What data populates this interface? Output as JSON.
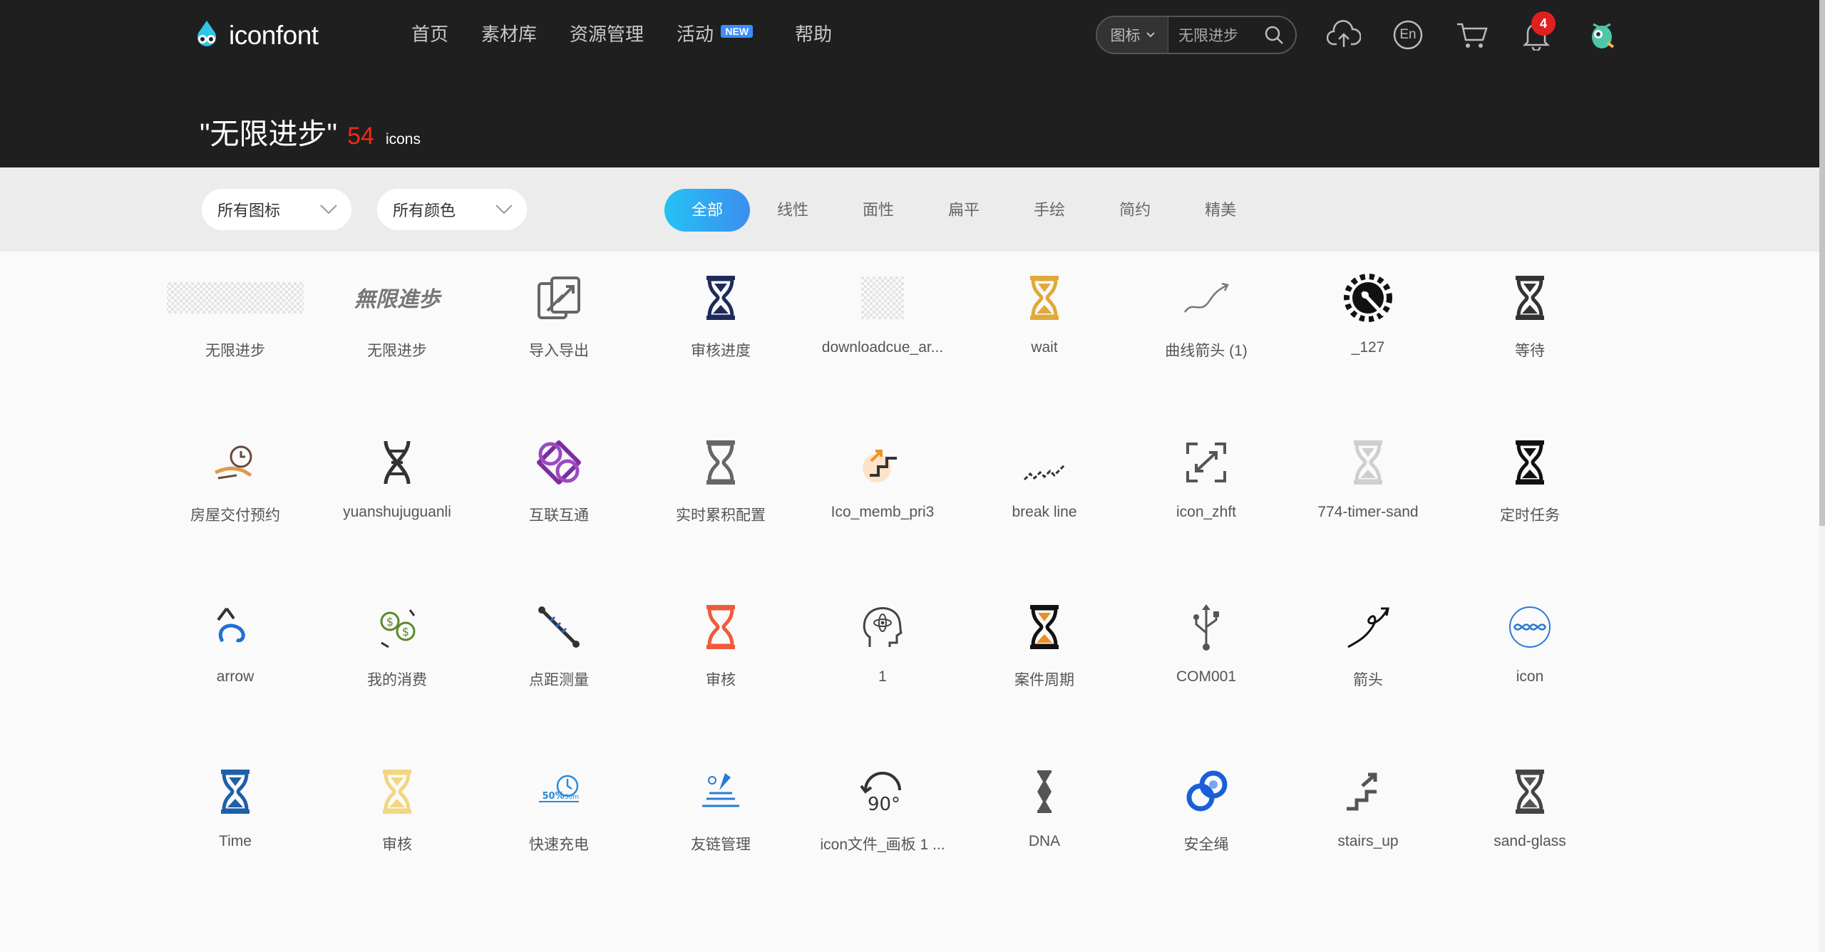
{
  "header": {
    "logo_text": "iconfont",
    "nav": [
      {
        "label": "首页"
      },
      {
        "label": "素材库"
      },
      {
        "label": "资源管理"
      },
      {
        "label": "活动",
        "badge": "NEW"
      },
      {
        "label": "帮助"
      }
    ],
    "search": {
      "type": "图标",
      "value": "无限进步"
    },
    "lang": "En",
    "notifications": "4"
  },
  "title": {
    "query": "\"无限进步\"",
    "count": "54",
    "unit": "icons"
  },
  "filters": {
    "type_dropdown": "所有图标",
    "color_dropdown": "所有颜色",
    "tabs": [
      "全部",
      "线性",
      "面性",
      "扁平",
      "手绘",
      "简约",
      "精美"
    ],
    "active_tab": "全部"
  },
  "colors": {
    "accent_start": "#25c2f2",
    "accent_end": "#3b8ef0",
    "count_red": "#f02a1a",
    "header_bg": "#1f1f1f"
  },
  "icons": [
    {
      "name": "无限进步",
      "icon": "checker-text"
    },
    {
      "name": "无限进步",
      "icon": "stylized-text"
    },
    {
      "name": "导入导出",
      "icon": "import-export-icon"
    },
    {
      "name": "审核进度",
      "icon": "hourglass-navy"
    },
    {
      "name": "downloadcue_ar...",
      "icon": "checker-blank"
    },
    {
      "name": "wait",
      "icon": "hourglass-gold"
    },
    {
      "name": "曲线箭头 (1)",
      "icon": "curve-arrow"
    },
    {
      "name": "_127",
      "icon": "gear-black"
    },
    {
      "name": "等待",
      "icon": "hourglass-outline"
    },
    {
      "name": "房屋交付预约",
      "icon": "hand-clock"
    },
    {
      "name": "yuanshujuguanli",
      "icon": "dna-dark"
    },
    {
      "name": "互联互通",
      "icon": "interlink-purple"
    },
    {
      "name": "实时累积配置",
      "icon": "hourglass-gray"
    },
    {
      "name": "Ico_memb_pri3",
      "icon": "stairs-orange"
    },
    {
      "name": "break line",
      "icon": "break-line"
    },
    {
      "name": "icon_zhft",
      "icon": "swap-box"
    },
    {
      "name": "774-timer-sand",
      "icon": "hourglass-light"
    },
    {
      "name": "定时任务",
      "icon": "hourglass-bold"
    },
    {
      "name": "arrow",
      "icon": "arrow-swirl"
    },
    {
      "name": "我的消费",
      "icon": "money-green"
    },
    {
      "name": "点距测量",
      "icon": "measure"
    },
    {
      "name": "审核",
      "icon": "hourglass-red"
    },
    {
      "name": "1",
      "icon": "head-atom"
    },
    {
      "name": "案件周期",
      "icon": "hourglass-black-orange"
    },
    {
      "name": "COM001",
      "icon": "usb"
    },
    {
      "name": "箭头",
      "icon": "arrow-loop"
    },
    {
      "name": "icon",
      "icon": "dna-circle"
    },
    {
      "name": "Time",
      "icon": "hourglass-blue"
    },
    {
      "name": "审核",
      "icon": "hourglass-yellow"
    },
    {
      "name": "快速充电",
      "icon": "fast-charge"
    },
    {
      "name": "友链管理",
      "icon": "link-manage"
    },
    {
      "name": "icon文件_画板 1 ...",
      "icon": "rotate-90"
    },
    {
      "name": "DNA",
      "icon": "dna-gray"
    },
    {
      "name": "安全绳",
      "icon": "safety-rope"
    },
    {
      "name": "stairs_up",
      "icon": "stairs-up"
    },
    {
      "name": "sand-glass",
      "icon": "hourglass-sand"
    }
  ]
}
